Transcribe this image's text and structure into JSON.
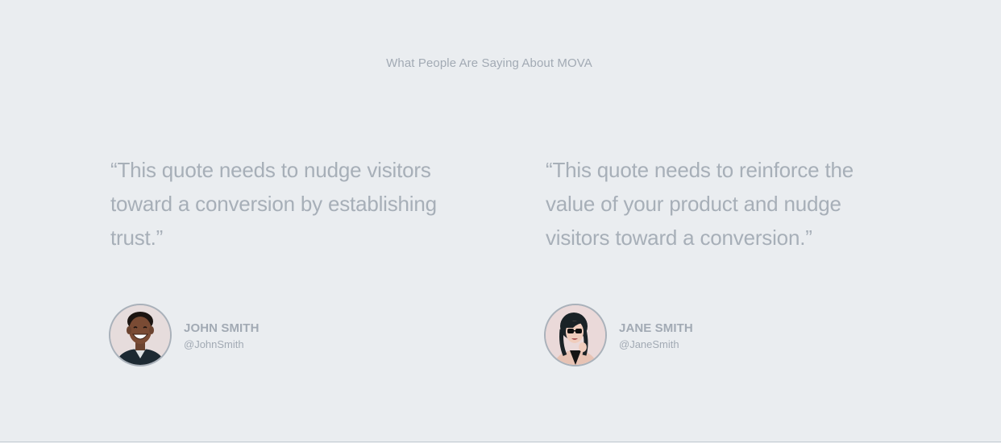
{
  "section": {
    "heading": "What People Are Saying About MOVA"
  },
  "testimonials": [
    {
      "quote": "“This quote needs to nudge visitors toward a conversion by establishing trust.”",
      "name": "JOHN SMITH",
      "handle": "@JohnSmith",
      "avatar_icon": "avatar-photo-man"
    },
    {
      "quote": "“This quote needs to reinforce the value of your product and nudge visitors toward a conversion.”",
      "name": "JANE SMITH",
      "handle": "@JaneSmith",
      "avatar_icon": "avatar-photo-woman"
    }
  ],
  "colors": {
    "background": "#eaedf0",
    "text": "#a2aab4",
    "quote_text": "#a7afb8"
  }
}
